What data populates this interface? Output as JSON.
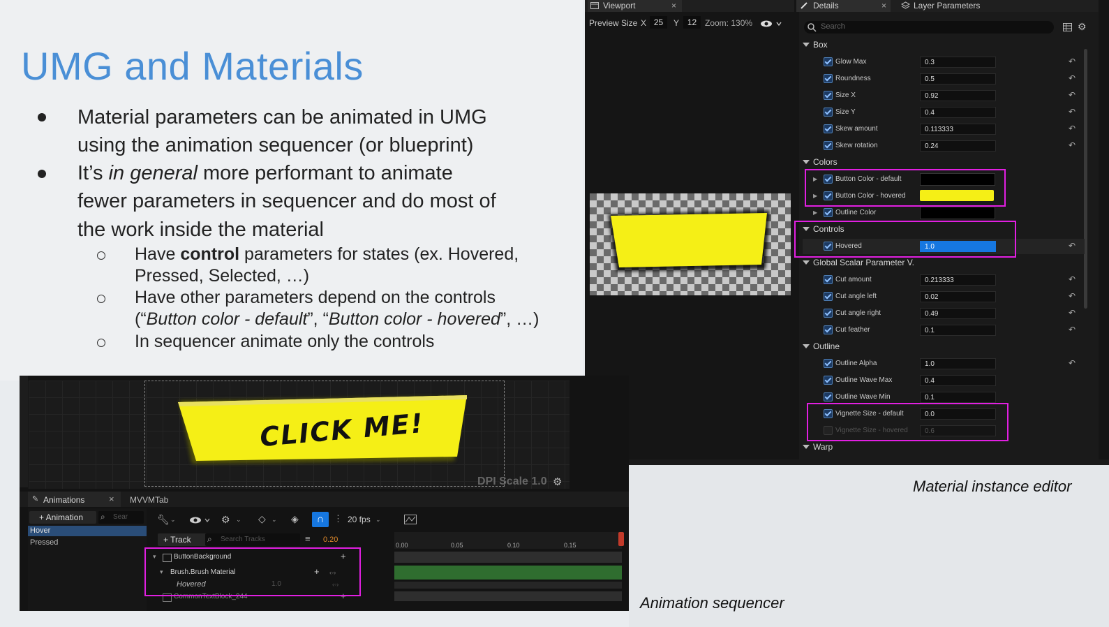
{
  "slide": {
    "title": "UMG and Materials",
    "bullets": [
      {
        "line1": "Material parameters can be animated in UMG",
        "line2": "using the animation sequencer (or blueprint)"
      },
      {
        "pre": "It’s ",
        "em": "in general",
        "post": " more performant to animate",
        "line2": "fewer parameters in sequencer and do most of",
        "line3": "the work inside the material"
      }
    ],
    "sub": [
      {
        "pre": "Have ",
        "strong": "control",
        "post": " parameters for states (ex. Hovered,",
        "line2": "Pressed, Selected, …)"
      },
      {
        "line1": "Have other parameters depend on the controls",
        "line2_open": "(“",
        "line2_em1": "Button color - default",
        "line2_mid": "”, “",
        "line2_em2": "Button color - hovered",
        "line2_close": "”, …)"
      },
      {
        "line1": "In sequencer animate only the controls"
      }
    ]
  },
  "viewport": {
    "tab": "Viewport",
    "preview_label": "Preview Size",
    "x_label": "X",
    "x_value": "25",
    "y_label": "Y",
    "y_value": "12",
    "zoom": "Zoom: 130%"
  },
  "details": {
    "tab": "Details",
    "tab2": "Layer Parameters",
    "search_placeholder": "Search",
    "sections": {
      "box": "Box",
      "colors": "Colors",
      "controls": "Controls",
      "global": "Global Scalar Parameter V.",
      "outline": "Outline",
      "warp": "Warp"
    },
    "box": [
      {
        "name": "Glow Max",
        "value": "0.3"
      },
      {
        "name": "Roundness",
        "value": "0.5"
      },
      {
        "name": "Size X",
        "value": "0.92"
      },
      {
        "name": "Size Y",
        "value": "0.4"
      },
      {
        "name": "Skew amount",
        "value": "0.113333"
      },
      {
        "name": "Skew rotation",
        "value": "0.24"
      }
    ],
    "colors": [
      {
        "name": "Button Color - default",
        "color": "#000000"
      },
      {
        "name": "Button Color - hovered",
        "color": "#f5ef16"
      },
      {
        "name": "Outline Color",
        "color": "#000000"
      }
    ],
    "controls": [
      {
        "name": "Hovered",
        "value": "1.0"
      }
    ],
    "global": [
      {
        "name": "Cut amount",
        "value": "0.213333"
      },
      {
        "name": "Cut angle left",
        "value": "0.02"
      },
      {
        "name": "Cut angle right",
        "value": "0.49"
      },
      {
        "name": "Cut feather",
        "value": "0.1"
      }
    ],
    "outline": [
      {
        "name": "Outline Alpha",
        "value": "1.0"
      },
      {
        "name": "Outline Wave Max",
        "value": "0.4"
      },
      {
        "name": "Outline Wave Min",
        "value": "0.1"
      },
      {
        "name": "Vignette Size - default",
        "value": "0.0"
      },
      {
        "name": "Vignette Size - hovered",
        "value": "0.6"
      }
    ]
  },
  "designer": {
    "button_text": "CLICK ME!",
    "dpi": "DPI Scale 1.0"
  },
  "sequencer": {
    "tab_animations": "Animations",
    "tab_mvvm": "MVVMTab",
    "add_animation": "+ Animation",
    "search_anim": "Sear",
    "animations": [
      "Hover",
      "Pressed"
    ],
    "fps": "20 fps",
    "add_track": "+ Track",
    "search_tracks": "Search Tracks",
    "current_time": "0.20",
    "ticks": [
      "0.00",
      "0.05",
      "0.10",
      "0.15"
    ],
    "tracks": [
      {
        "name": "ButtonBackground"
      },
      {
        "name": "Brush.Brush Material"
      },
      {
        "name": "Hovered",
        "value": "1.0"
      },
      {
        "name": "CommonTextBlock_244"
      }
    ]
  },
  "captions": {
    "material": "Material instance editor",
    "sequencer": "Animation sequencer"
  },
  "colors": {
    "highlight": "#e11fe1",
    "accent_blue": "#1677e0",
    "button_yellow": "#f5ef16",
    "title_blue": "#4a8fd6"
  }
}
